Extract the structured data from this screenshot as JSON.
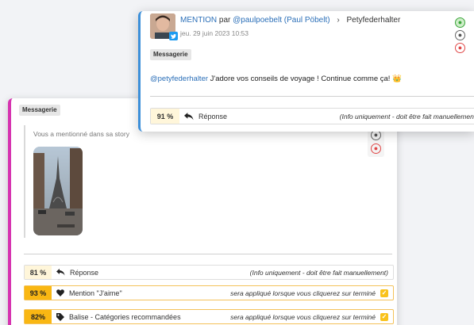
{
  "back_card": {
    "tag": "Messagerie",
    "story_caption": "Vous a mentionné dans sa story",
    "rows": [
      {
        "pct": "81 %",
        "label": "Réponse",
        "note": "(Info uniquement - doit être fait manuellement)"
      },
      {
        "pct": "93 %",
        "label": "Mention \"J'aime\"",
        "note": "sera appliqué lorsque vous cliquerez sur terminé"
      },
      {
        "pct": "82%",
        "label": "Balise - Catégories recommandées",
        "note": "sera appliqué lorsque vous cliquerez sur terminé"
      }
    ]
  },
  "front_card": {
    "type": "MENTION",
    "by": "par",
    "author": "@paulpoebelt (Paul Pöbelt)",
    "separator": "›",
    "recipient": "Petyfederhalter",
    "date": "jeu. 29 juin 2023 10:53",
    "tag": "Messagerie",
    "mention": "@petyfederhalter",
    "message": " J'adore vos conseils de voyage ! Continue comme ça!",
    "emoji": "👑",
    "row": {
      "pct": "91 %",
      "label": "Réponse",
      "note": "(Info uniquement - doit être fait manuellement)"
    }
  },
  "colors": {
    "accent_magenta": "#d633b0",
    "accent_blue": "#3c8fd9",
    "accent_yellow": "#f9b713"
  },
  "icons": [
    "reply-icon",
    "heart-icon",
    "tag-icon",
    "checkbox-icon",
    "neutral-face-icon",
    "sad-face-icon",
    "happy-face-icon",
    "twitter-icon"
  ]
}
